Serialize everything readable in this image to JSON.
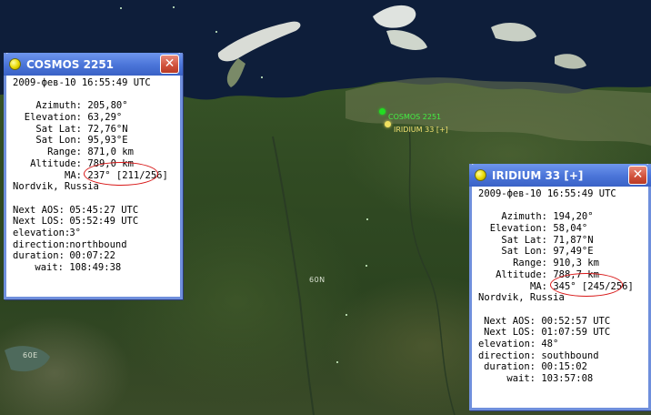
{
  "map": {
    "grid_labels": [
      "60N",
      "60E"
    ],
    "satellites": [
      {
        "name": "COSMOS 2251",
        "color": "#22dd22"
      },
      {
        "name": "IRIDIUM 33 [+]",
        "color": "#f0e060"
      }
    ]
  },
  "windows": [
    {
      "title": "COSMOS 2251",
      "close": "✕",
      "timestamp": "2009-фев-10 16:55:49 UTC",
      "fields": [
        {
          "label": "Azimuth:",
          "value": "205,80°"
        },
        {
          "label": "Elevation:",
          "value": "63,29°"
        },
        {
          "label": "Sat Lat:",
          "value": "72,76°N"
        },
        {
          "label": "Sat Lon:",
          "value": "95,93°E"
        },
        {
          "label": "Range:",
          "value": "871,0 km"
        },
        {
          "label": "Altitude:",
          "value": "789,0 km"
        },
        {
          "label": "MA:",
          "value": "237° [211/256]"
        }
      ],
      "location": "Nordvik, Russia",
      "pass": [
        {
          "label": "Next AOS:",
          "value": "05:45:27 UTC"
        },
        {
          "label": "Next LOS:",
          "value": "05:52:49 UTC"
        },
        {
          "label": "elevation:",
          "value": "3°"
        },
        {
          "label": "direction:",
          "value": "northbound"
        },
        {
          "label": "duration:",
          "value": "00:07:22"
        },
        {
          "label": "wait:",
          "value": "108:49:38"
        }
      ]
    },
    {
      "title": "IRIDIUM 33 [+]",
      "close": "✕",
      "timestamp": "2009-фев-10 16:55:49 UTC",
      "fields": [
        {
          "label": "Azimuth:",
          "value": "194,20°"
        },
        {
          "label": "Elevation:",
          "value": "58,04°"
        },
        {
          "label": "Sat Lat:",
          "value": "71,87°N"
        },
        {
          "label": "Sat Lon:",
          "value": "97,49°E"
        },
        {
          "label": "Range:",
          "value": "910,3 km"
        },
        {
          "label": "Altitude:",
          "value": "788,7 km"
        },
        {
          "label": "MA:",
          "value": "345° [245/256]"
        }
      ],
      "location": "Nordvik, Russia",
      "pass": [
        {
          "label": "Next AOS:",
          "value": "00:52:57 UTC"
        },
        {
          "label": "Next LOS:",
          "value": "01:07:59 UTC"
        },
        {
          "label": "elevation:",
          "value": "48°"
        },
        {
          "label": "direction:",
          "value": "southbound"
        },
        {
          "label": "duration:",
          "value": "00:15:02"
        },
        {
          "label": "wait:",
          "value": "103:57:08"
        }
      ]
    }
  ]
}
